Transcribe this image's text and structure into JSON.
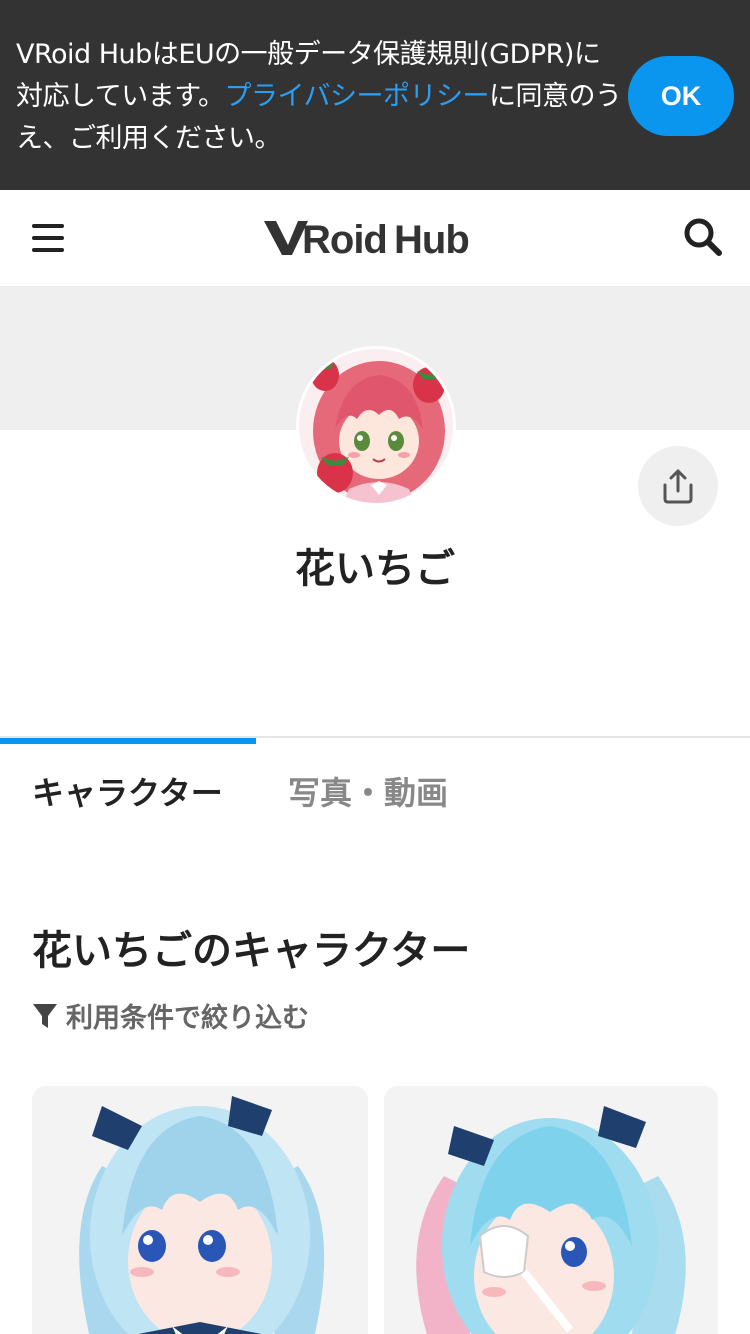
{
  "gdpr": {
    "text_before": "VRoid HubはEUの一般データ保護規則(GDPR)に対応しています。",
    "link_text": "プライバシーポリシー",
    "text_after": "に同意のうえ、ご利用ください。",
    "ok_label": "OK"
  },
  "header": {
    "logo": "VRoid Hub",
    "menu_icon": "hamburger-icon",
    "search_icon": "search-icon"
  },
  "profile": {
    "name": "花いちご",
    "share_icon": "share-icon"
  },
  "tabs": [
    {
      "label": "キャラクター",
      "active": true
    },
    {
      "label": "写真・動画",
      "active": false
    }
  ],
  "section": {
    "title": "花いちごのキャラクター",
    "filter_label": "利用条件で絞り込む",
    "filter_icon": "filter-icon"
  },
  "colors": {
    "accent": "#0a96ef",
    "banner_bg": "#333333",
    "link": "#2a9df4"
  }
}
